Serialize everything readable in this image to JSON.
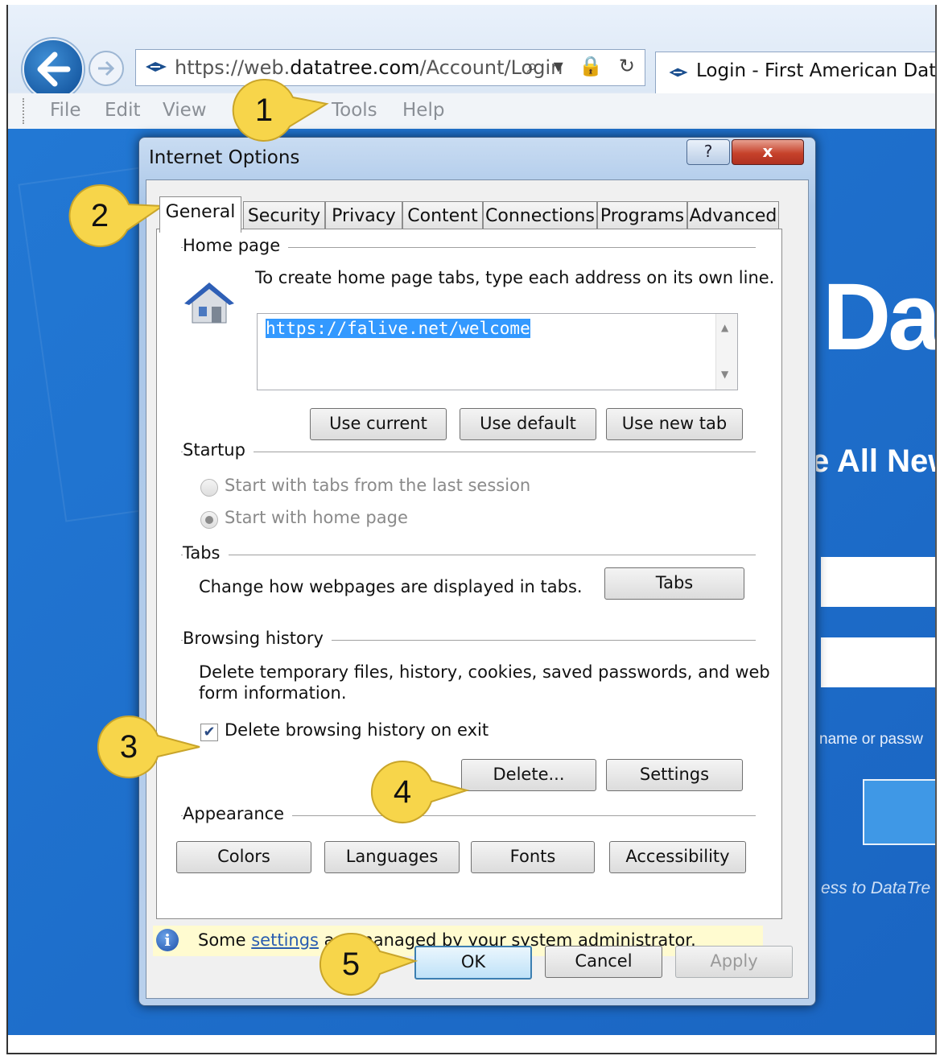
{
  "browser": {
    "address_prefix": "https://web.",
    "address_domain": "datatree.com",
    "address_suffix": "/Account/Login",
    "address_icons": "⌕ ▾ 🔒 ↻",
    "tab_title": "Login - First American Data..."
  },
  "menu": [
    "File",
    "Edit",
    "View",
    "Tools",
    "Help"
  ],
  "page": {
    "brand_partial": "Dat",
    "tagline_partial": "e All New",
    "hint_partial": "name or passw",
    "access_partial": "ess to DataTre"
  },
  "dialog": {
    "title": "Internet Options",
    "help_label": "?",
    "close_label": "x",
    "tabs": [
      "General",
      "Security",
      "Privacy",
      "Content",
      "Connections",
      "Programs",
      "Advanced"
    ],
    "home_page": {
      "label": "Home page",
      "instruction": "To create home page tabs, type each address on its own line.",
      "url": "https://falive.net/welcome",
      "buttons": {
        "use_current": "Use current",
        "use_default": "Use default",
        "use_new_tab": "Use new tab"
      }
    },
    "startup": {
      "label": "Startup",
      "option1": "Start with tabs from the last session",
      "option2": "Start with home page"
    },
    "tabs_section": {
      "label": "Tabs",
      "text": "Change how webpages are displayed in tabs.",
      "button": "Tabs"
    },
    "browsing_history": {
      "label": "Browsing history",
      "text_line1": "Delete temporary files, history, cookies, saved passwords, and web",
      "text_line2": "form information.",
      "checkbox_label": "Delete browsing history on exit",
      "checkbox_checked": true,
      "delete_button": "Delete...",
      "settings_button": "Settings"
    },
    "appearance": {
      "label": "Appearance",
      "buttons": {
        "colors": "Colors",
        "languages": "Languages",
        "fonts": "Fonts",
        "accessibility": "Accessibility"
      }
    },
    "info_bar": {
      "prefix": "Some ",
      "link": "settings",
      "suffix": " are managed by your system administrator."
    },
    "footer": {
      "ok": "OK",
      "cancel": "Cancel",
      "apply": "Apply"
    }
  },
  "callouts": [
    "1",
    "2",
    "3",
    "4",
    "5"
  ],
  "colors": {
    "callout_fill": "#f7d54a",
    "page_blue": "#1f6fcc",
    "selection": "#3399ff"
  }
}
